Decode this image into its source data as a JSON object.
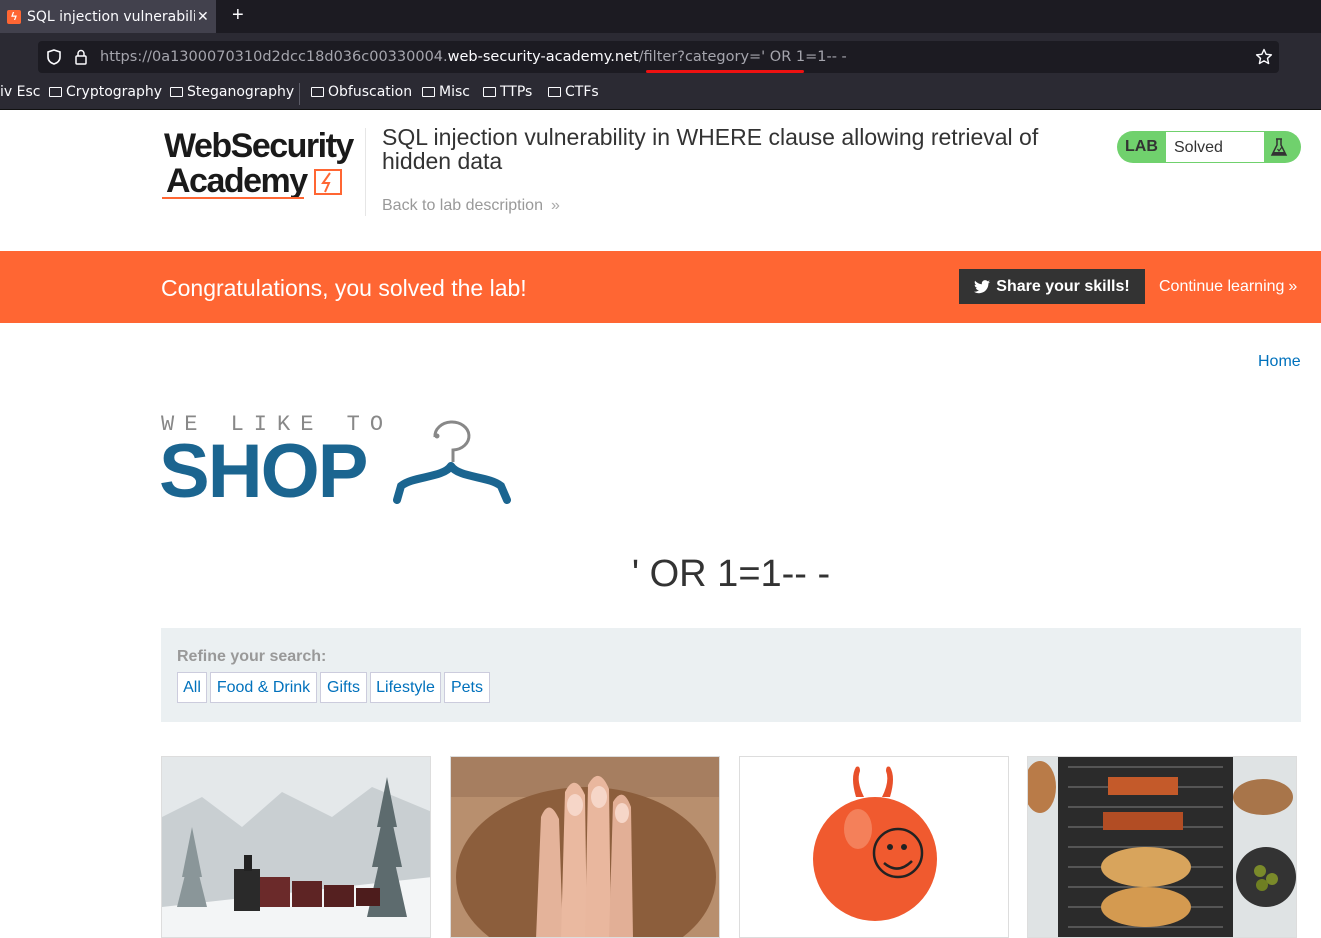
{
  "browser": {
    "tab_title": "SQL injection vulnerability",
    "new_tab_label": "+",
    "close_label": "✕",
    "url_prefix": "https://0a1300070310d2dcc18d036c00330004.",
    "url_host": "web-security-academy.net",
    "url_path": "/filter?category=' OR 1=1-- -",
    "bookmarks": [
      "iv Esc",
      "Cryptography",
      "Steganography",
      "Obfuscation",
      "Misc",
      "TTPs",
      "CTFs"
    ]
  },
  "header": {
    "logo_line1": "WebSecurity",
    "logo_line2": "Academy",
    "lab_title": "SQL injection vulnerability in WHERE clause allowing retrieval of hidden data",
    "back_link": "Back to lab description",
    "lab_label": "LAB",
    "lab_status": "Solved"
  },
  "banner": {
    "message": "Congratulations, you solved the lab!",
    "share_label": "Share your skills!",
    "continue_label": "Continue learning"
  },
  "shop": {
    "home_link": "Home",
    "tagline_top": "WE LIKE TO",
    "tagline_main": "SHOP",
    "category_heading": "' OR 1=1-- -",
    "refine_label": "Refine your search:",
    "filters": [
      "All",
      "Food & Drink",
      "Gifts",
      "Lifestyle",
      "Pets"
    ]
  },
  "colors": {
    "accent": "#ff6633",
    "link": "#0071bc",
    "solved": "#70d16d",
    "shop_blue": "#1b6590"
  }
}
